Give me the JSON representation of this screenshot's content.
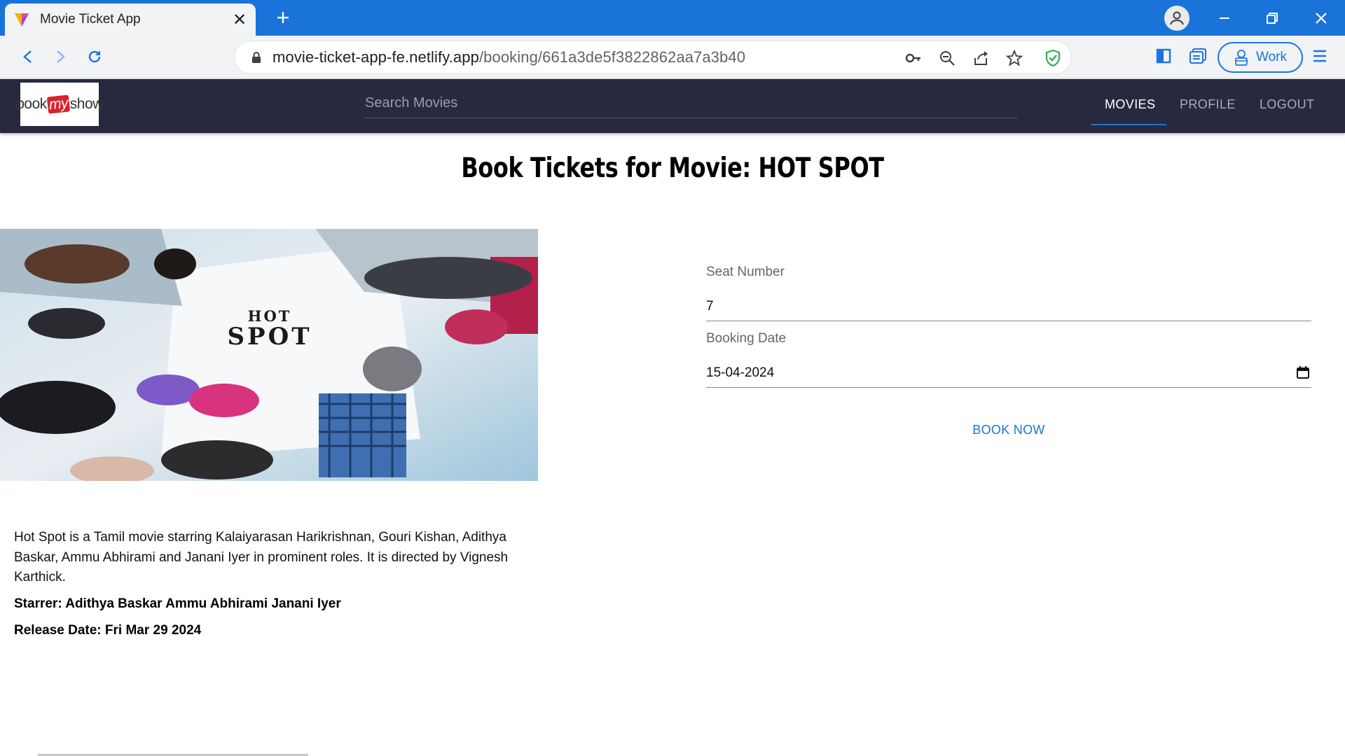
{
  "browser": {
    "tab_title": "Movie Ticket App",
    "url_host": "movie-ticket-app-fe.netlify.app",
    "url_path": "/booking/661a3de5f3822862aa7a3b40",
    "profile_label": "Work"
  },
  "app": {
    "logo_parts": [
      "book",
      "my",
      "show"
    ],
    "search_placeholder": "Search Movies",
    "nav": [
      "MOVIES",
      "PROFILE",
      "LOGOUT"
    ],
    "active_nav": "MOVIES"
  },
  "page": {
    "title": "Book Tickets for Movie: HOT SPOT",
    "poster_text_line1": "HOT",
    "poster_text_line2": "SPOT",
    "description": "Hot Spot is a Tamil movie starring Kalaiyarasan Harikrishnan, Gouri Kishan, Adithya Baskar, Ammu Abhirami and Janani Iyer in prominent roles. It is directed by Vignesh Karthick.",
    "starrer": "Starrer: Adithya Baskar Ammu Abhirami Janani Iyer",
    "release": "Release Date: Fri Mar 29 2024"
  },
  "form": {
    "seat_label": "Seat Number",
    "seat_value": "7",
    "date_label": "Booking Date",
    "date_value": "15-04-2024",
    "submit_label": "BOOK NOW"
  },
  "colors": {
    "tabbar": "#1a73d9",
    "appbar": "#272a3f",
    "accent": "#1976d2"
  }
}
